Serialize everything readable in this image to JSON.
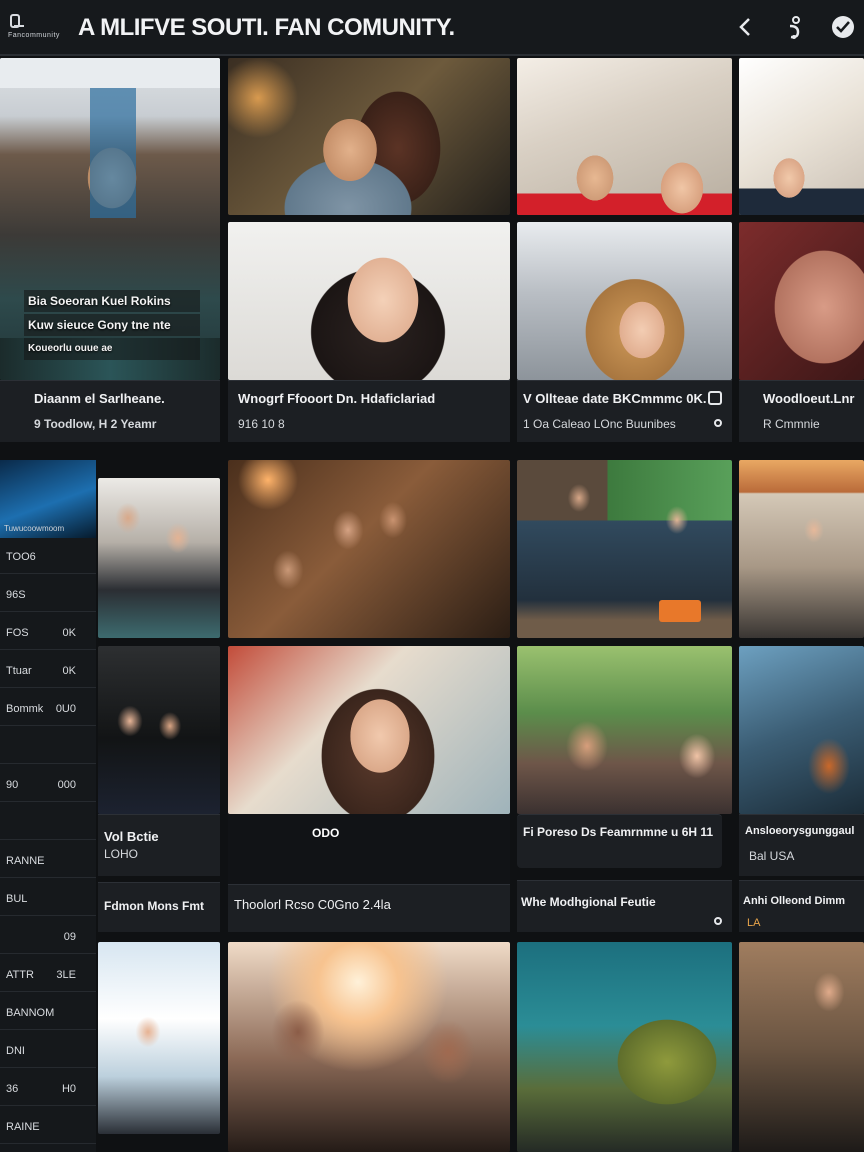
{
  "app": {
    "logo_text": "Fancommunity",
    "title": "A MLIFVE SOUTI. FAN COMUNITY."
  },
  "header_icons": [
    "chevron-left-icon",
    "share-icon",
    "check-icon"
  ],
  "store_sign": {
    "line1": "Bia Soeoran Kuel Rokins",
    "line2": "Kuw sieuce Gony tne nte",
    "line3": "Koueorlu ouue ae"
  },
  "captions": {
    "c1": {
      "title": "Diaanm el Sarlheane.",
      "sub": "9 Toodlow, H 2 Yeamr"
    },
    "c2": {
      "title": "Wnogrf Ffooort Dn. Hdaficlariad",
      "sub": "916 10 8"
    },
    "c3": {
      "title": "V Ollteae date BKCmmmc 0K.",
      "sub": "1 Oa Caleao LOnc Buunibes"
    },
    "c4": {
      "title": "Woodloeut.Lnr",
      "sub": "R Cmmnie"
    },
    "c5": {
      "title": "Vol Bctie",
      "sub": "LOHO"
    },
    "c6": {
      "title": "Fdmon Mons Fmt",
      "sub": ""
    },
    "c7": {
      "title": "Thoolorl Rcso C0Gno 2.4la",
      "sub": ""
    },
    "c8": {
      "title": "Whe Modhgional Feutie",
      "sub": ""
    },
    "c9": {
      "title": "Fi Poreso Ds Feamrnmne  u 6H 11",
      "sub": ""
    },
    "c10": {
      "title": "Ansloeorysgunggaul",
      "sub": "Bal USA"
    },
    "c11": {
      "title": "Anhi Olleond Dimm",
      "sub": "LA"
    },
    "mid_badge": "ODO"
  },
  "sidebar": {
    "header": "Tuwucoowmoom",
    "rows": [
      {
        "k": "TOO6",
        "v": ""
      },
      {
        "k": "96S",
        "v": ""
      },
      {
        "k": "FOS",
        "v": "0K"
      },
      {
        "k": "Ttuar",
        "v": "0K"
      },
      {
        "k": "Bommk",
        "v": "0U0"
      },
      {
        "k": "",
        "v": ""
      },
      {
        "k": "90",
        "v": "000"
      },
      {
        "k": "",
        "v": ""
      },
      {
        "k": "RANNE",
        "v": ""
      },
      {
        "k": "BUL",
        "v": ""
      },
      {
        "k": "",
        "v": "09"
      },
      {
        "k": "ATTR",
        "v": "3LE"
      },
      {
        "k": "BANNOM",
        "v": ""
      },
      {
        "k": "DNI",
        "v": ""
      },
      {
        "k": "36",
        "v": "H0"
      },
      {
        "k": "RAINE",
        "v": ""
      }
    ]
  },
  "colors": {
    "accent": "#e8a54b",
    "background": "#0f1113",
    "panel": "#1c1f23"
  }
}
